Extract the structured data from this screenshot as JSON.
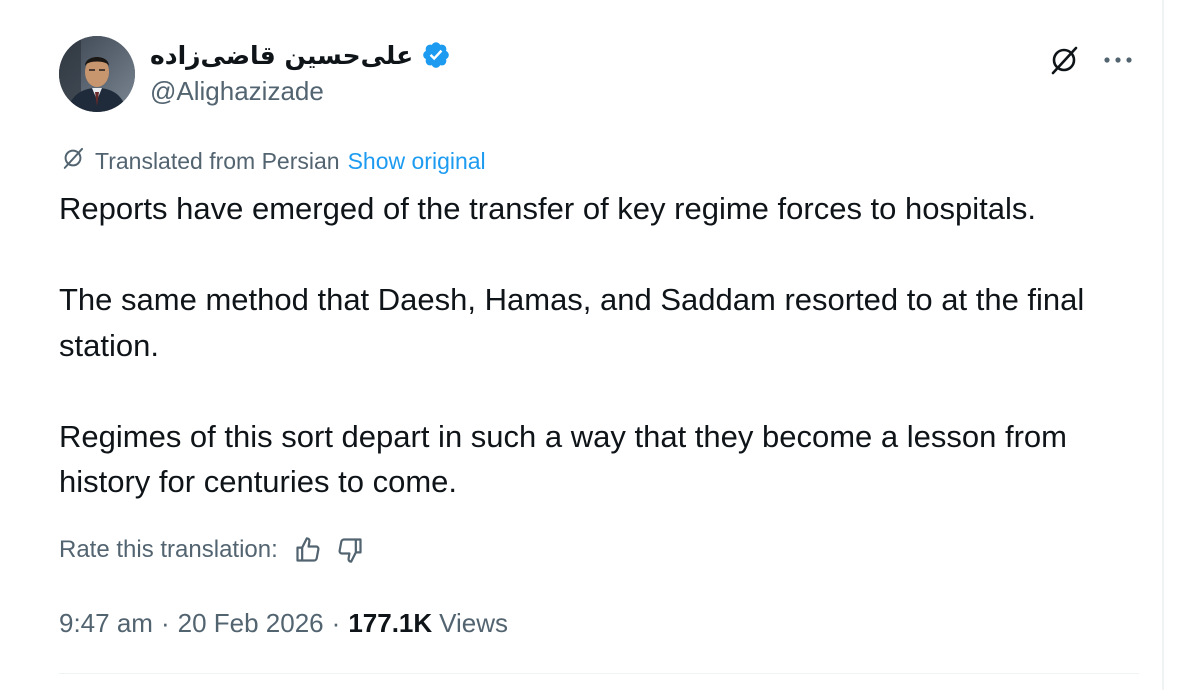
{
  "author": {
    "display_name": "علی‌حسین قاضی‌زاده",
    "handle": "@Alighazizade",
    "verified": true
  },
  "translation": {
    "label": "Translated from Persian",
    "show_original": "Show original"
  },
  "tweet": {
    "paragraphs": [
      "Reports have emerged of the transfer of key regime forces to hospitals.",
      "The same method that Daesh, Hamas, and Saddam resorted to at the final station.",
      "Regimes of this sort depart in such a way that they become a lesson from history for centuries to come."
    ]
  },
  "rating": {
    "label": "Rate this translation:"
  },
  "meta": {
    "time": "9:47 am",
    "separator": "·",
    "date": "20 Feb 2026",
    "views_count": "177.1K",
    "views_label": "Views"
  },
  "icons": {
    "grok": "grok-icon",
    "more": "more-icon",
    "translate": "translate-icon",
    "verified": "verified-badge-icon",
    "thumbs_up": "thumbs-up-icon",
    "thumbs_down": "thumbs-down-icon"
  },
  "colors": {
    "text_primary": "#0f1419",
    "text_secondary": "#536471",
    "link": "#1d9bf0",
    "verified": "#1d9bf0"
  }
}
